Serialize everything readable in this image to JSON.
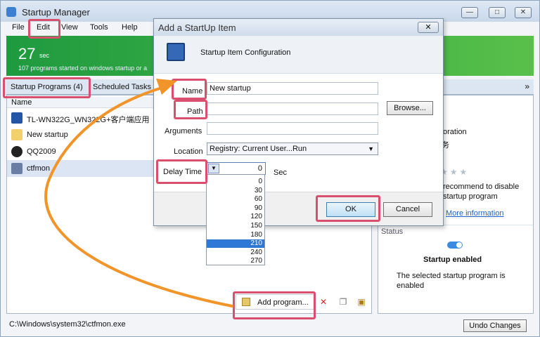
{
  "window": {
    "title": "Startup Manager"
  },
  "menu": [
    "File",
    "Edit",
    "View",
    "Tools",
    "Help"
  ],
  "banner": {
    "count": "27",
    "unit": "sec",
    "message": "107 programs started on windows startup or a"
  },
  "tabs": [
    "Startup Programs (4)",
    "Scheduled Tasks"
  ],
  "list": {
    "header": "Name",
    "items": [
      {
        "label": "TL-WN322G_WN322G+客户端应用",
        "icon": "network-icon"
      },
      {
        "label": "New startup",
        "icon": "folder-icon"
      },
      {
        "label": "QQ2009",
        "icon": "qq-icon"
      },
      {
        "label": "ctfmon",
        "icon": "edit-icon"
      }
    ]
  },
  "toolbar": {
    "add_program": "Add program..."
  },
  "details": {
    "corp": "oration",
    "corp2": "务",
    "recommend": "recommend to disable startup program",
    "more_info": "More information",
    "status_header": "Status",
    "status_title": "Startup enabled",
    "status_desc": "The selected startup program is enabled"
  },
  "statusbar": {
    "path": "C:\\Windows\\system32\\ctfmon.exe",
    "undo": "Undo Changes"
  },
  "dialog": {
    "title": "Add a StartUp Item",
    "close": "✕",
    "header": "Startup Item Configuration",
    "name_label": "Name",
    "name_value": "New startup",
    "path_label": "Path",
    "path_value": "",
    "browse": "Browse...",
    "args_label": "Arguments",
    "location_label": "Location",
    "location_value": "Registry: Current User...Run",
    "delay_label": "Delay Time",
    "delay_value": "0",
    "delay_unit": "Sec",
    "ok": "OK",
    "cancel": "Cancel"
  },
  "delay_options": [
    "0",
    "30",
    "60",
    "90",
    "120",
    "150",
    "180",
    "210",
    "240",
    "270"
  ],
  "delay_selected": "210"
}
